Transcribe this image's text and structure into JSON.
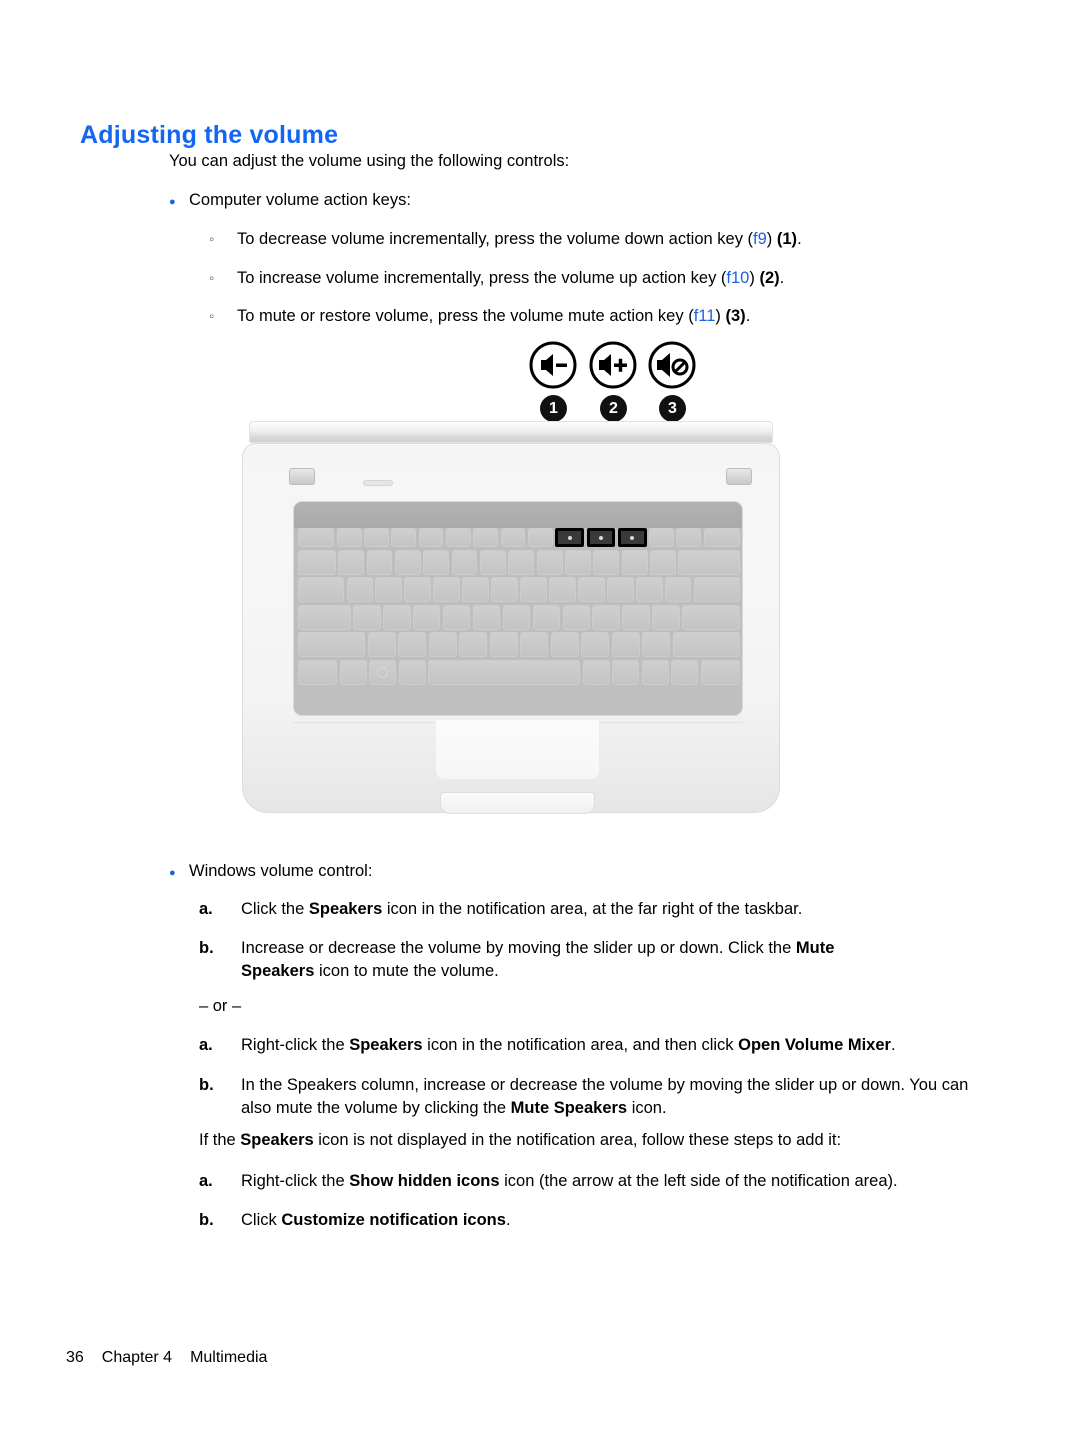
{
  "document": {
    "heading": "Adjusting the volume",
    "heading_color": "#1166F2",
    "accent_color": "#1B62E0",
    "intro": "You can adjust the volume using the following controls:"
  },
  "section_keys": {
    "bullet_label": "Computer volume action keys:",
    "items": [
      {
        "pre": "To decrease volume incrementally, press the volume down action key (",
        "fkey": "f9",
        "mid": ") ",
        "callout": "(1)",
        "post": "."
      },
      {
        "pre": "To increase volume incrementally, press the volume up action key (",
        "fkey": "f10",
        "mid": ") ",
        "callout": "(2)",
        "post": "."
      },
      {
        "pre": "To mute or restore volume, press the volume mute action key (",
        "fkey": "f11",
        "mid": ") ",
        "callout": "(3)",
        "post": "."
      }
    ]
  },
  "figure": {
    "alt": "HP notebook computer keyboard with volume action keys highlighted",
    "icons": [
      {
        "name": "volume-down-icon",
        "callout": "1"
      },
      {
        "name": "volume-up-icon",
        "callout": "2"
      },
      {
        "name": "volume-mute-icon",
        "callout": "3"
      }
    ]
  },
  "section_windows": {
    "bullet_label": "Windows volume control:",
    "group_one": [
      {
        "marker": "a.",
        "parts": [
          {
            "t": "Click the ",
            "b": false
          },
          {
            "t": "Speakers",
            "b": true
          },
          {
            "t": " icon in the notification area, at the far right of the taskbar.",
            "b": false
          }
        ]
      },
      {
        "marker": "b.",
        "parts": [
          {
            "t": "Increase or decrease the volume by moving the slider up or down. Click the ",
            "b": false
          },
          {
            "t": "Mute Speakers",
            "b": true
          },
          {
            "t": " icon to mute the volume.",
            "b": false
          }
        ]
      }
    ],
    "or_divider": "– or –",
    "group_two": [
      {
        "marker": "a.",
        "parts": [
          {
            "t": "Right-click the ",
            "b": false
          },
          {
            "t": "Speakers",
            "b": true
          },
          {
            "t": " icon in the notification area, and then click ",
            "b": false
          },
          {
            "t": "Open Volume Mixer",
            "b": true
          },
          {
            "t": ".",
            "b": false
          }
        ]
      },
      {
        "marker": "b.",
        "parts": [
          {
            "t": "In the Speakers column, increase or decrease the volume by moving the slider up or down. You can also mute the volume by clicking the ",
            "b": false
          },
          {
            "t": "Mute Speakers",
            "b": true
          },
          {
            "t": " icon.",
            "b": false
          }
        ]
      }
    ],
    "note": [
      {
        "t": "If the ",
        "b": false
      },
      {
        "t": "Speakers",
        "b": true
      },
      {
        "t": " icon is not displayed in the notification area, follow these steps to add it:",
        "b": false
      }
    ],
    "group_three": [
      {
        "marker": "a.",
        "parts": [
          {
            "t": "Right-click the ",
            "b": false
          },
          {
            "t": "Show hidden icons",
            "b": true
          },
          {
            "t": " icon (the arrow at the left side of the notification area).",
            "b": false
          }
        ]
      },
      {
        "marker": "b.",
        "parts": [
          {
            "t": "Click ",
            "b": false
          },
          {
            "t": "Customize notification icons",
            "b": true
          },
          {
            "t": ".",
            "b": false
          }
        ]
      }
    ]
  },
  "footer": {
    "page_number": "36",
    "chapter": "Chapter 4",
    "chapter_title": "Multimedia"
  }
}
